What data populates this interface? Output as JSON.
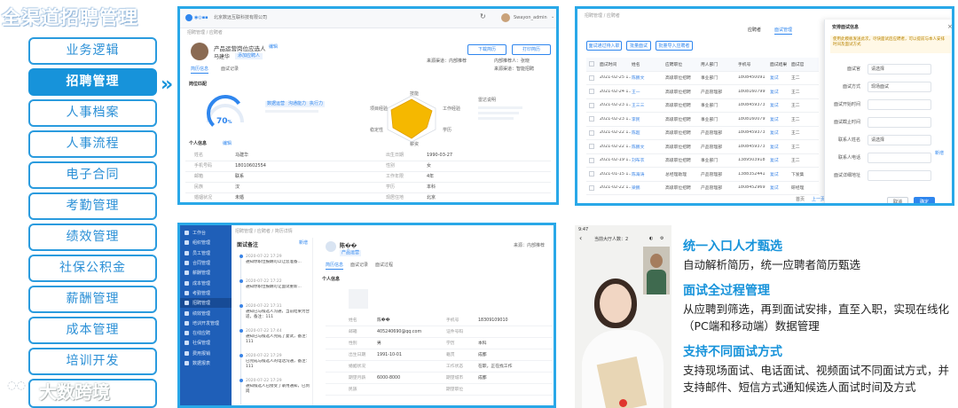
{
  "header": {
    "title": "全渠道招聘管理"
  },
  "sidebar": {
    "items": [
      {
        "label": "业务逻辑",
        "active": false
      },
      {
        "label": "招聘管理",
        "active": true
      },
      {
        "label": "人事档案",
        "active": false
      },
      {
        "label": "人事流程",
        "active": false
      },
      {
        "label": "电子合同",
        "active": false
      },
      {
        "label": "考勤管理",
        "active": false
      },
      {
        "label": "绩效管理",
        "active": false
      },
      {
        "label": "社保公积金",
        "active": false
      },
      {
        "label": "薪酬管理",
        "active": false
      },
      {
        "label": "成本管理",
        "active": false
      },
      {
        "label": "培训开发",
        "active": false
      }
    ],
    "pointer": "»"
  },
  "watermark": {
    "text": "大数跨境",
    "icon": "logo-bubble-icon"
  },
  "screen1": {
    "company": "北京数远互联科技有限公司",
    "user": "Swayon_admin",
    "breadcrumb": "招聘管理 / 应聘者",
    "job": "产品运营岗位应选人",
    "candidate": "马建华",
    "tag": "添加应聘人",
    "btn_download": "下载简历",
    "btn_print": "打印简历",
    "source1": "来源渠道：内部推荐",
    "source2": "内部推荐人：张晓",
    "source3": "来源渠道：智能招聘",
    "tabs": [
      "简历信息",
      "面试记录"
    ],
    "section_match": "岗位匹配",
    "score": "70",
    "score_unit": "%",
    "match_tags": [
      "数据运营",
      "沟通能力",
      "执行力"
    ],
    "radar_labels": [
      "技能",
      "工作经验",
      "学历",
      "薪资",
      "稳定性",
      "项目经验"
    ],
    "radar_note": "雷达说明",
    "section_info": "个人信息",
    "edit": "编辑",
    "info": [
      [
        "姓名",
        "马建华",
        "出生日期",
        "1990-03-27"
      ],
      [
        "手机号码",
        "18010602554",
        "性别",
        "女"
      ],
      [
        "邮箱",
        "联系",
        "工作年限",
        "4年"
      ],
      [
        "民族",
        "汉",
        "学历",
        "本科"
      ],
      [
        "婚姻状况",
        "未婚",
        "现居住地",
        "北京"
      ]
    ]
  },
  "screen2": {
    "breadcrumb": "招聘管理 / 应聘者",
    "tabs": [
      "应聘者",
      "面试管理"
    ],
    "buttons": [
      "面试通过待入职",
      "批量面试",
      "批量导入应聘者"
    ],
    "columns": [
      "面试时间",
      "姓名",
      "应聘职位",
      "用人部门",
      "手机号",
      "面试结果",
      "面试官"
    ],
    "rows": [
      [
        "2021-02-25 1...",
        "陈鹏文",
        "高级职位招聘",
        "事业部门",
        "1808450091",
        "复试",
        "王二"
      ],
      [
        "2021-02-24 1...",
        "王一",
        "高级职位招聘",
        "产品管理部",
        "1808160799",
        "复试",
        "王二"
      ],
      [
        "2021-02-23 1...",
        "王三三",
        "高级职位招聘",
        "事业部门",
        "1808459373",
        "复试",
        "王二"
      ],
      [
        "2021-02-23 1...",
        "李民",
        "高级职位招聘",
        "事业部门",
        "1808160079",
        "复试",
        "王二"
      ],
      [
        "2021-02-22 1...",
        "陈超",
        "高级职位招聘",
        "产品管理部",
        "1808459373",
        "复试",
        "王二"
      ],
      [
        "2021-02-22 1...",
        "陈鹏文",
        "高级职位招聘",
        "产品管理部",
        "1808459373",
        "复试",
        "王二"
      ],
      [
        "2021-02-19 1...",
        "刘布衣",
        "高级职位招聘",
        "事业部门",
        "1389503918",
        "复试",
        "王二"
      ],
      [
        "2021-01-15 1...",
        "陈海涛",
        "总经理助理",
        "产品管理部",
        "1388352441",
        "复试",
        "下发集"
      ],
      [
        "2021-02-22 1...",
        "梁鹏",
        "高级职位招聘",
        "产品管理部",
        "1808452969",
        "复试",
        "研经理"
      ]
    ],
    "dialog": {
      "title": "安排面试信息",
      "notice": "使用此模板发送此次，尽快面试后应聘者，可以提前与本人安排时间及面试方式",
      "fields": [
        {
          "label": "面试官",
          "value": "请选择"
        },
        {
          "label": "面试方式",
          "value": "现场面试"
        },
        {
          "label": "面试开始时间",
          "value": ""
        },
        {
          "label": "面试截止时间",
          "value": ""
        },
        {
          "label": "联系人姓名",
          "value": "请选择"
        },
        {
          "label": "联系人电话",
          "value": ""
        },
        {
          "label": "面试详细地址",
          "value": ""
        }
      ],
      "link": "新增",
      "cancel": "取消",
      "confirm": "确定"
    },
    "pager": [
      "首页",
      "上一页"
    ]
  },
  "screen3": {
    "breadcrumb": "招聘管理 / 应聘者 / 简历详情",
    "side_items": [
      "工作台",
      "组织管理",
      "员工管理",
      "合同管理",
      "薪酬管理",
      "成本管理",
      "考勤管理",
      "招聘管理",
      "绩效管理",
      "培训开发管理",
      "在线应聘",
      "社保管理",
      "费用报销",
      "数据报表"
    ],
    "panel_title": "面试备注",
    "add": "新增",
    "timeline": [
      {
        "time": "2020-07-22 17:29",
        "text": "通知你职位报酬可以让您准备..."
      },
      {
        "time": "2020-07-22 17:22",
        "text": "通知你职位报酬可让面试重新..."
      },
      {
        "time": "2020-07-22 17:31",
        "text": "通知已与候选人沟通，当前结果为合适，备注：111"
      },
      {
        "time": "2020-07-22 17:44",
        "text": "通知已与候选人完成了复试，备注：111"
      },
      {
        "time": "2020-07-22 17:29",
        "text": "已完成与候选人的电话沟通，备注：111"
      },
      {
        "time": "2020-07-22 17:29",
        "text": "通知候选人已接受了录用通知，已到岗"
      }
    ],
    "name": "陈��",
    "job_label": "产品运营",
    "tabs": [
      "简历信息",
      "面试记录",
      "面试过程"
    ],
    "source": "来源：内部推荐",
    "section": "个人信息",
    "info": [
      [
        "姓名",
        "陈��",
        "手机号",
        "18309109010"
      ],
      [
        "邮箱",
        "405240690@qq.com",
        "证件号码",
        ""
      ],
      [
        "性别",
        "男",
        "学历",
        "本科"
      ],
      [
        "出生日期",
        "1991-10-01",
        "籍贯",
        "成都"
      ],
      [
        "婚姻状况",
        "",
        "工作状态",
        "在职，正在找工作"
      ],
      [
        "期望月薪",
        "6000-8000",
        "期望城市",
        "成都"
      ],
      [
        "民族",
        "",
        "期望职位",
        ""
      ]
    ]
  },
  "screen4": {
    "time": "9:47",
    "status": "当前大厅人数：2",
    "icons": [
      "back-icon",
      "camera-icon",
      "settings-icon"
    ]
  },
  "features": [
    {
      "title": "统一入口人才甄选",
      "desc": "自动解析简历，统一应聘者简历甄选"
    },
    {
      "title": "面试全过程管理",
      "desc": "从应聘到筛选，再到面试安排，直至入职，实现在线化（PC端和移动端）数据管理"
    },
    {
      "title": "支持不同面试方式",
      "desc": "支持现场面试、电话面试、视频面试不同面试方式，并支持邮件、短信方式通知候选人面试时间及方式"
    }
  ],
  "colors": {
    "accent": "#1793da",
    "border": "#29a8e8",
    "primary_btn": "#2f86ee",
    "radar_fill": "#f5b800"
  }
}
